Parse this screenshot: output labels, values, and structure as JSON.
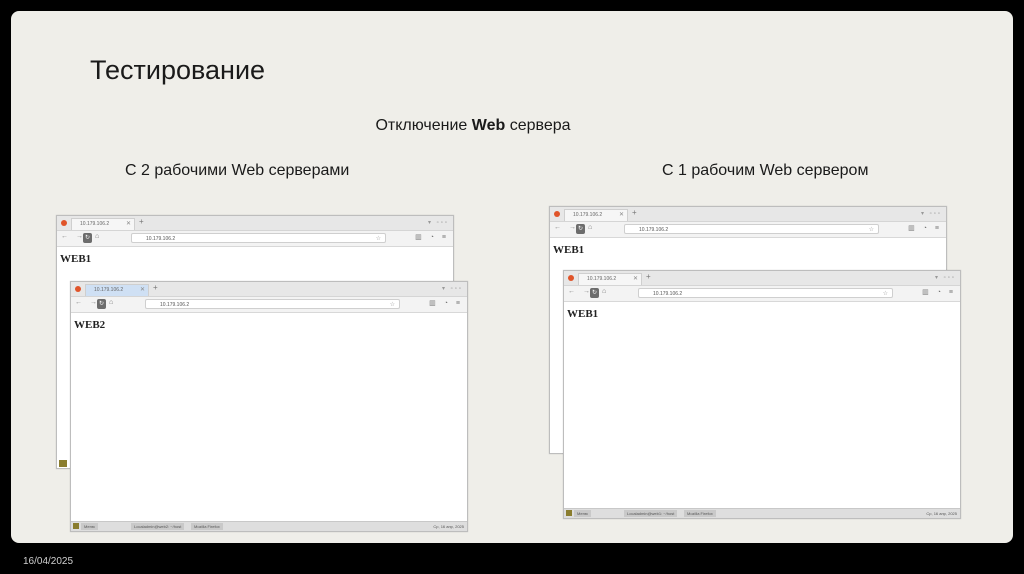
{
  "slide": {
    "title": "Тестирование",
    "subtitle_prefix": "Отключение ",
    "subtitle_bold": "Web",
    "subtitle_suffix": " сервера",
    "caption_left": "С 2 рабочими Web серверами",
    "caption_right": "С 1 рабочим Web сервером",
    "date": "16/04/2025"
  },
  "windows": {
    "left_back": {
      "tab": "10.179.106.2",
      "url": "10.179.106.2",
      "heading": "WEB1"
    },
    "left_front": {
      "tab": "10.179.106.2",
      "url": "10.179.106.2",
      "heading": "WEB2",
      "taskbar": [
        "Меню",
        "Localadmin@web2: ~/host",
        "Mozilla Firefox"
      ],
      "clock": "Ср, 16 апр, 2025"
    },
    "right_back": {
      "tab": "10.179.106.2",
      "url": "10.179.106.2",
      "heading": "WEB1"
    },
    "right_front": {
      "tab": "10.179.106.2",
      "url": "10.179.106.2",
      "heading": "WEB1",
      "taskbar": [
        "Меню",
        "Localadmin@web1: ~/host",
        "Mozilla Firefox"
      ],
      "clock": "Ср, 16 апр, 2025"
    }
  }
}
